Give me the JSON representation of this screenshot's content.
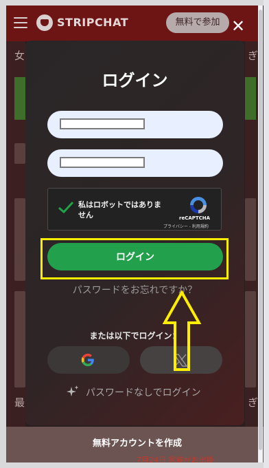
{
  "header": {
    "logo_text": "STRIPCHAT",
    "join_label": "無料で参加"
  },
  "background": {
    "frag_left_1": "女",
    "frag_left_2": "最",
    "frag_right_1": "ぎ",
    "frag_right_2": "ぎ",
    "frag_bottom_text": "7月24日 家族がお出掛"
  },
  "modal": {
    "title": "ログイン",
    "username_placeholder": "",
    "password_placeholder": "",
    "captcha": {
      "label": "私はロボットではありません",
      "brand": "reCAPTCHA",
      "links": "プライバシー - 利用規約"
    },
    "login_button": "ログイン",
    "forgot_password": "パスワードをお忘れですか？",
    "or_login_with": "または以下でログイン：",
    "passwordless": "パスワードなしでログイン",
    "create_account": "無料アカウントを作成"
  },
  "colors": {
    "login_green": "#22a04c",
    "highlight_yellow": "#ffee00",
    "field_bg": "#e8efff"
  },
  "icons": {
    "close": "close-icon",
    "menu": "hamburger-icon",
    "google": "google-icon",
    "x": "x-icon",
    "sparkle": "sparkle-icon",
    "recaptcha": "recaptcha-icon",
    "check": "checkmark-icon"
  }
}
